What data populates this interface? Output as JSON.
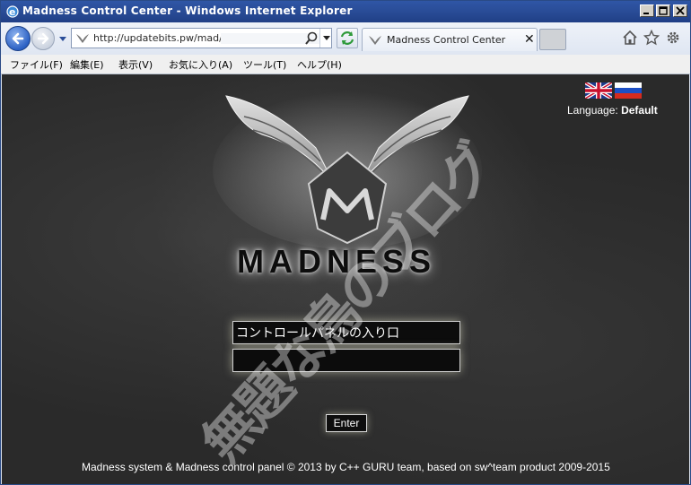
{
  "window": {
    "title": "Madness Control Center - Windows Internet Explorer",
    "buttons": [
      "minimize",
      "maximize",
      "close"
    ]
  },
  "navbar": {
    "address_url": "http://updatebits.pw/mad/",
    "tab_label": "Madness Control Center",
    "tab_close": "✕",
    "icons": [
      "back-arrow-icon",
      "forward-arrow-icon",
      "search-icon",
      "refresh-icon",
      "home-icon",
      "star-icon",
      "gear-icon"
    ]
  },
  "menu": {
    "items": [
      "ファイル(F)",
      "編集(E)",
      "表示(V)",
      "お気に入り(A)",
      "ツール(T)",
      "ヘルプ(H)"
    ]
  },
  "page": {
    "language_label": "Language:",
    "language_value": "Default",
    "flags": [
      "uk-flag-icon",
      "russia-flag-icon"
    ],
    "brand": "MADNESS",
    "input_1_value": "コントロールパネルの入り口",
    "input_2_value": "",
    "enter_label": "Enter",
    "footer": "Madness system & Madness control panel © 2013 by C++ GURU team, based on sw^team product 2009-2015",
    "watermark": "無題な鳥のブログ"
  }
}
